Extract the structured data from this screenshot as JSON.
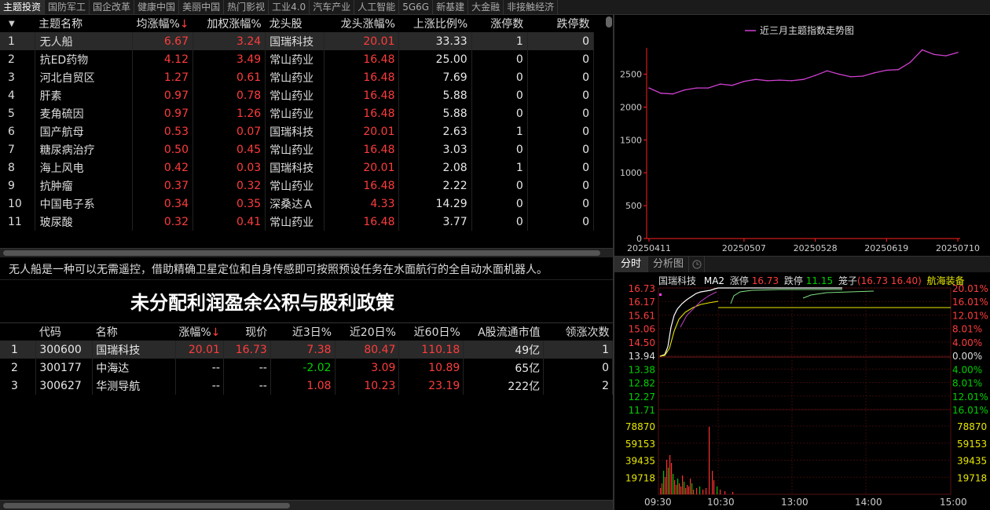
{
  "top_tabs": [
    "主题投资",
    "国防军工",
    "国企改革",
    "健康中国",
    "美丽中国",
    "热门影视",
    "工业4.0",
    "汽车产业",
    "人工智能",
    "5G6G",
    "新基建",
    "大金融",
    "非接触经济"
  ],
  "theme_table": {
    "headers": [
      "",
      "主题名称",
      "均涨幅%",
      "加权涨幅%",
      "龙头股",
      "龙头涨幅%",
      "上涨比例%",
      "涨停数",
      "跌停数"
    ],
    "sort_arrow": "↓",
    "rows": [
      [
        "1",
        "无人船",
        "6.67",
        "3.24",
        "国瑞科技",
        "20.01",
        "33.33",
        "1",
        "0"
      ],
      [
        "2",
        "抗ED药物",
        "4.12",
        "3.49",
        "常山药业",
        "16.48",
        "25.00",
        "0",
        "0"
      ],
      [
        "3",
        "河北自贸区",
        "1.27",
        "0.61",
        "常山药业",
        "16.48",
        "7.69",
        "0",
        "0"
      ],
      [
        "4",
        "肝素",
        "0.97",
        "0.78",
        "常山药业",
        "16.48",
        "5.88",
        "0",
        "0"
      ],
      [
        "5",
        "麦角硫因",
        "0.97",
        "1.26",
        "常山药业",
        "16.48",
        "5.88",
        "0",
        "0"
      ],
      [
        "6",
        "国产航母",
        "0.53",
        "0.07",
        "国瑞科技",
        "20.01",
        "2.63",
        "1",
        "0"
      ],
      [
        "7",
        "糖尿病治疗",
        "0.50",
        "0.45",
        "常山药业",
        "16.48",
        "3.03",
        "0",
        "0"
      ],
      [
        "8",
        "海上风电",
        "0.42",
        "0.03",
        "国瑞科技",
        "20.01",
        "2.08",
        "1",
        "0"
      ],
      [
        "9",
        "抗肿瘤",
        "0.37",
        "0.32",
        "常山药业",
        "16.48",
        "2.22",
        "0",
        "0"
      ],
      [
        "10",
        "中国电子系",
        "0.34",
        "0.35",
        "深桑达Ａ",
        "4.33",
        "14.29",
        "0",
        "0"
      ],
      [
        "11",
        "玻尿酸",
        "0.32",
        "0.41",
        "常山药业",
        "16.48",
        "3.77",
        "0",
        "0"
      ]
    ]
  },
  "description": "无人船是一种可以无需遥控，借助精确卫星定位和自身传感即可按照预设任务在水面航行的全自动水面机器人。",
  "banner": "未分配利润盈余公积与股利政策",
  "stock_table": {
    "headers": [
      "",
      "代码",
      "名称",
      "涨幅%",
      "现价",
      "近3日%",
      "近20日%",
      "近60日%",
      "A股流通市值",
      "领涨次数"
    ],
    "rows": [
      [
        "1",
        "300600",
        "国瑞科技",
        "20.01",
        "16.73",
        "7.38",
        "80.47",
        "110.18",
        "49亿",
        "1"
      ],
      [
        "2",
        "300177",
        "中海达",
        "--",
        "--",
        "-2.02",
        "3.09",
        "10.89",
        "65亿",
        "0"
      ],
      [
        "3",
        "300627",
        "华测导航",
        "--",
        "--",
        "1.08",
        "10.23",
        "23.19",
        "222亿",
        "2"
      ]
    ]
  },
  "trend_chart": {
    "legend": "近三月主题指数走势图",
    "line_color": "#d040d0"
  },
  "chart_data": [
    {
      "type": "line",
      "legend": "近三月主题指数走势图",
      "x_ticks": [
        "20250411",
        "20250507",
        "20250528",
        "20250619",
        "20250710"
      ],
      "y_ticks": [
        0,
        500,
        1000,
        1500,
        2000,
        2500
      ],
      "ylim": [
        0,
        2900
      ],
      "x": [
        "20250411",
        "20250414",
        "20250417",
        "20250421",
        "20250424",
        "20250428",
        "20250501",
        "20250505",
        "20250507",
        "20250512",
        "20250515",
        "20250519",
        "20250522",
        "20250526",
        "20250528",
        "20250603",
        "20250606",
        "20250610",
        "20250613",
        "20250617",
        "20250619",
        "20250624",
        "20250627",
        "20250701",
        "20250704",
        "20250708",
        "20250710"
      ],
      "values": [
        2290,
        2210,
        2200,
        2260,
        2290,
        2290,
        2350,
        2330,
        2390,
        2420,
        2400,
        2410,
        2400,
        2420,
        2480,
        2550,
        2500,
        2460,
        2470,
        2520,
        2560,
        2570,
        2680,
        2870,
        2800,
        2780,
        2830
      ]
    },
    {
      "type": "line",
      "stock": "国瑞科技",
      "y_ticks_left": [
        "16.73",
        "16.17",
        "15.61",
        "15.06",
        "14.50",
        "13.94",
        "13.38",
        "12.82",
        "12.27",
        "11.71"
      ],
      "y_ticks_right": [
        "20.01%",
        "16.01%",
        "12.01%",
        "8.01%",
        "4.00%",
        "0.00%",
        "4.00%",
        "8.01%",
        "12.01%",
        "16.01%"
      ],
      "x_ticks": [
        "09:30",
        "10:30",
        "13:00",
        "14:00",
        "15:00"
      ],
      "volume_ticks": [
        "78870",
        "59153",
        "39435",
        "19718"
      ]
    }
  ],
  "bottom_right": {
    "tabs": [
      "分时",
      "分析图"
    ],
    "info": {
      "name": "国瑞科技",
      "ma": "MA2",
      "limit_up_label": "涨停",
      "limit_up": "16.73",
      "limit_down_label": "跌停",
      "limit_down": "11.15",
      "cage_label": "笼子",
      "cage_value": "(16.73 16.40)",
      "industry": "航海装备"
    }
  }
}
